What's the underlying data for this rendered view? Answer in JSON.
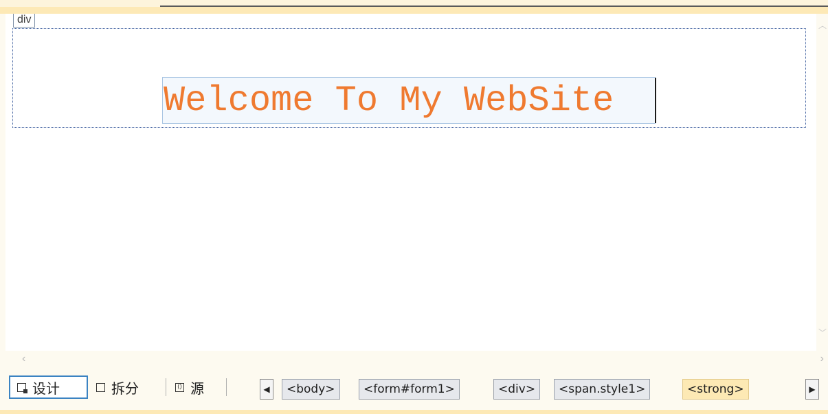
{
  "design_surface": {
    "block_tag_label": "div",
    "content_text": "Welcome To My WebSite",
    "text_color": "#ef7a30"
  },
  "view_tabs": [
    {
      "label": "设计",
      "icon": "design-view-icon",
      "active": true
    },
    {
      "label": "拆分",
      "icon": "split-view-icon",
      "active": false
    },
    {
      "label": "源",
      "icon": "source-view-icon",
      "active": false
    }
  ],
  "tag_breadcrumb": [
    {
      "label": "<body>",
      "active": false
    },
    {
      "label": "<form#form1>",
      "active": false
    },
    {
      "label": "<div>",
      "active": false
    },
    {
      "label": "<span.style1>",
      "active": false
    },
    {
      "label": "<strong>",
      "active": true
    }
  ],
  "breadcrumb_nav": {
    "prev_icon": "triangle-left-icon",
    "next_icon": "triangle-right-icon"
  },
  "colors": {
    "active_tab_border": "#3b83c2",
    "active_crumb_bg": "#fde9b4"
  }
}
